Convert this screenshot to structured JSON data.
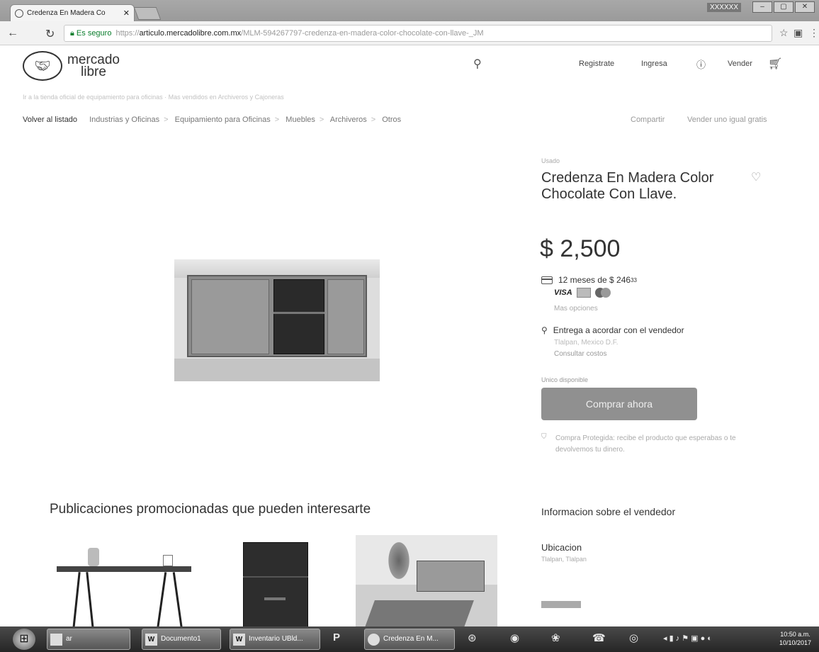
{
  "browser": {
    "tab_title": "Credenza En Madera Co",
    "tab_close": "✕",
    "window_user": "XXXXXX",
    "address": {
      "secure_label": "Es seguro",
      "url_scheme": "https://",
      "url_host": "articulo.mercadolibre.com.mx",
      "url_path": "/MLM-594267797-credenza-en-madera-color-chocolate-con-llave-_JM"
    }
  },
  "site": {
    "logo_text": "mercado libre",
    "nav": {
      "register": "Registrate",
      "login": "Ingresa",
      "sell": "Vender"
    },
    "breadcrumb_faint": "Ir a la tienda oficial de equipamiento para oficinas · Mas vendidos en Archiveros y Cajoneras",
    "breadcrumb_back": "Volver al listado",
    "breadcrumb": [
      "Industrias y Oficinas",
      "Equipamiento para Oficinas",
      "Muebles",
      "Archiveros",
      "Otros"
    ],
    "share": "Compartir",
    "sell_same": "Vender uno igual gratis"
  },
  "product": {
    "condition": "Usado",
    "title": "Credenza En Madera Color Chocolate Con Llave.",
    "price": "$ 2,500",
    "installments_text": "12 meses de $ 246",
    "installments_cents": "33",
    "visa": "VISA",
    "more_options": "Mas opciones",
    "shipping": "Entrega a acordar con el vendedor",
    "shipping_location": "Tlalpan, Mexico D.F.",
    "shipping_costs": "Consultar costos",
    "stock": "Unico disponible",
    "buy_button": "Comprar ahora",
    "guarantee": "Compra Protegida: recibe el producto que esperabas o te devolvemos tu dinero."
  },
  "promotions": {
    "title": "Publicaciones promocionadas que pueden interesarte"
  },
  "seller": {
    "title": "Informacion sobre el vendedor",
    "location_label": "Ubicacion",
    "location_value": "Tlalpan, Tlalpan"
  },
  "taskbar": {
    "items": [
      "ar",
      "Documento1",
      "Inventario UBld...",
      "Credenza En M..."
    ],
    "time": "10:50 a.m.",
    "date": "10/10/2017"
  }
}
